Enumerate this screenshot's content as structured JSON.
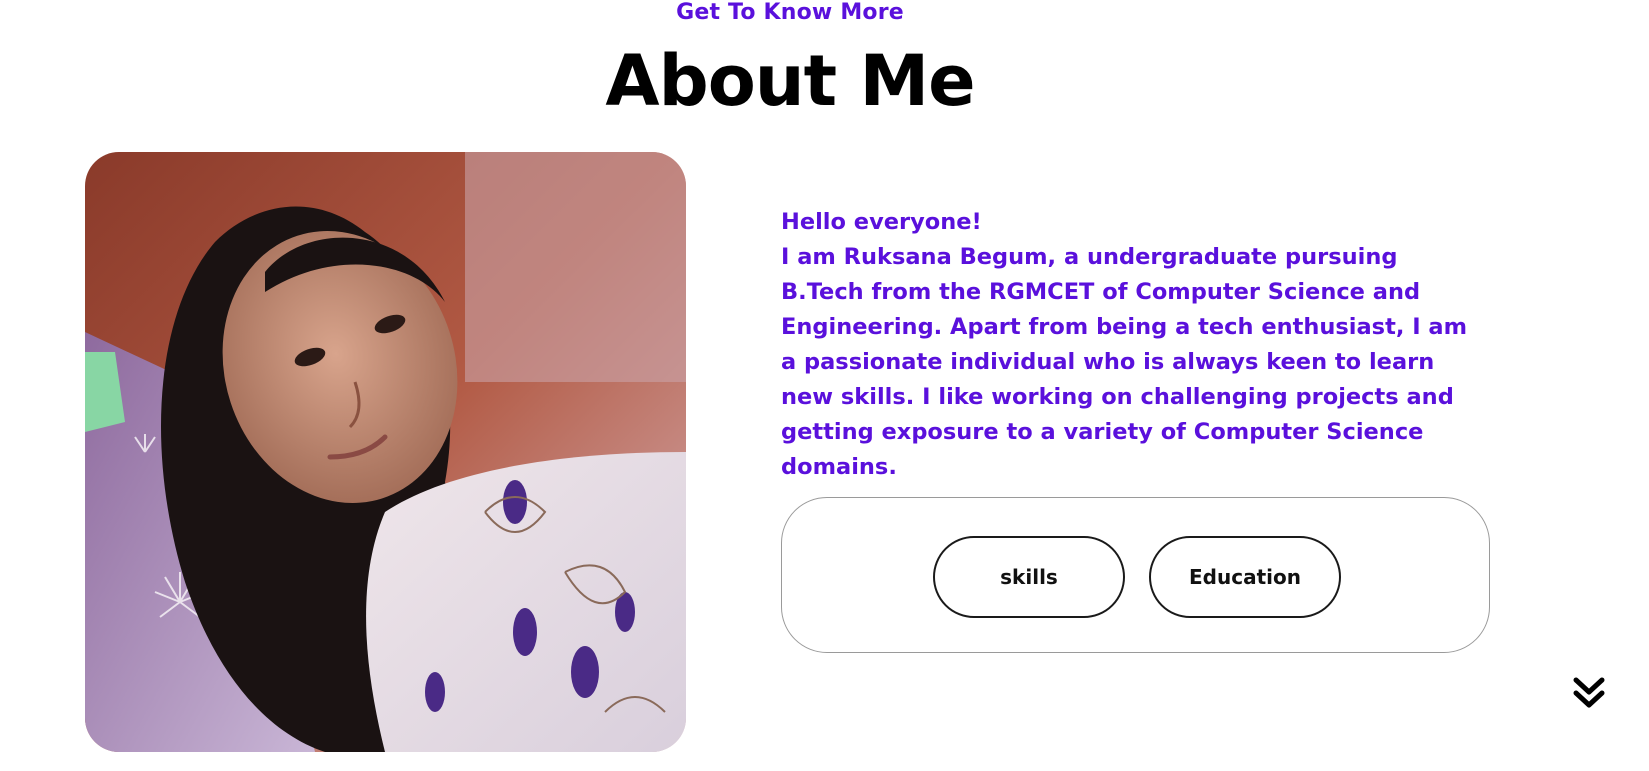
{
  "header": {
    "eyebrow": "Get To Know More",
    "title": "About Me"
  },
  "profile": {
    "image_alt": "Profile photo"
  },
  "intro": {
    "greeting": "Hello everyone!",
    "body": "I am Ruksana Begum, a undergraduate pursuing B.Tech from the RGMCET of Computer Science and Engineering. Apart from being a tech enthusiast, I am a passionate individual who is always keen to learn new skills. I like working on challenging projects and getting exposure to a variety of Computer Science domains."
  },
  "buttons": {
    "skills_label": "skills",
    "education_label": "Education"
  },
  "icons": {
    "scroll": "double-chevron-down-icon"
  },
  "colors": {
    "accent": "#5a10dc",
    "text": "#000000",
    "border": "#9a9a9a"
  }
}
